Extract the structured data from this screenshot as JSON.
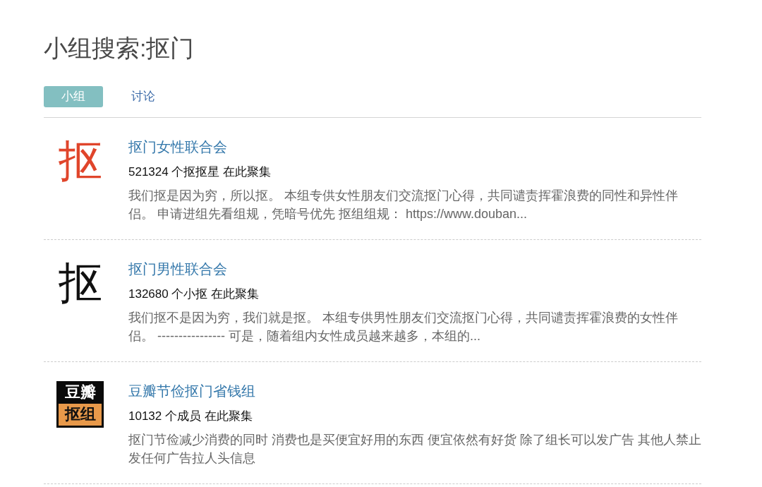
{
  "page": {
    "title": "小组搜索:抠门"
  },
  "tabs": [
    {
      "label": "小组",
      "selected": true
    },
    {
      "label": "讨论",
      "selected": false
    }
  ],
  "groups": [
    {
      "avatar": {
        "kind": "red",
        "text": "抠"
      },
      "name": "抠门女性联合会",
      "members": "521324 个抠抠星 在此聚集",
      "description": "我们抠是因为穷，所以抠。 本组专供女性朋友们交流抠门心得，共同谴责挥霍浪费的同性和异性伴侣。 申请进组先看组规，凭暗号优先 抠组组规： https://www.douban..."
    },
    {
      "avatar": {
        "kind": "ink",
        "text": "抠"
      },
      "name": "抠门男性联合会",
      "members": "132680 个小抠 在此聚集",
      "description": "我们抠不是因为穷，我们就是抠。 本组专供男性朋友们交流抠门心得，共同谴责挥霍浪费的女性伴侣。 ---------------- 可是，随着组内女性成员越来越多，本组的..."
    },
    {
      "avatar": {
        "kind": "badge",
        "lines": [
          "豆瓣",
          "抠组"
        ]
      },
      "name": "豆瓣节俭抠门省钱组",
      "members": "10132 个成员 在此聚集",
      "description": "抠门节俭减少消费的同时 消费也是买便宜好用的东西 便宜依然有好货 除了组长可以发广告 其他人禁止发任何广告拉人头信息"
    }
  ]
}
